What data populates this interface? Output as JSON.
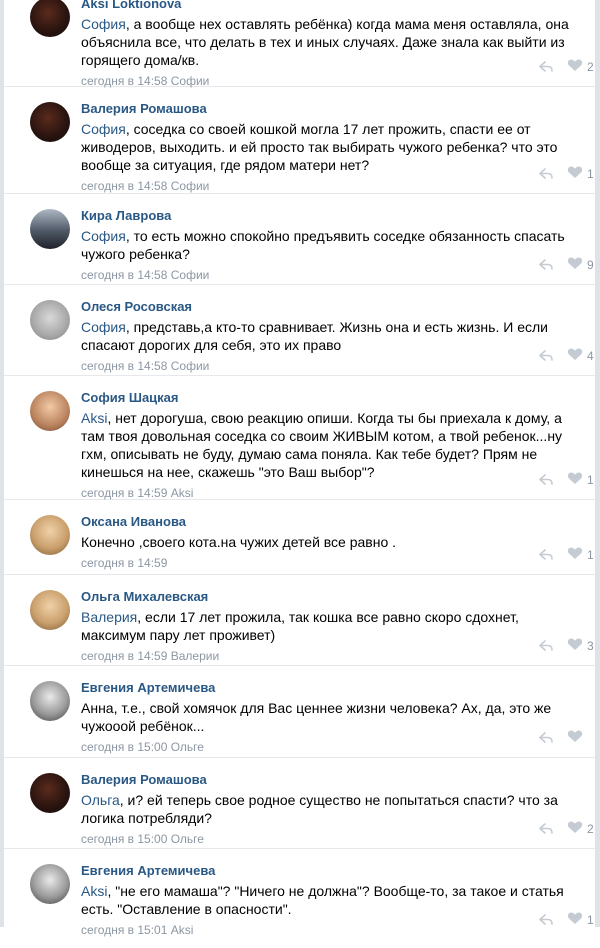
{
  "comments": [
    {
      "author": "Aksi Loktionova",
      "reply_to": "София",
      "text": ", а вообще нех оставлять ребёнка) когда мама меня оставляла, она объяснила все, что делать в тех и иных случаях. Даже знала как выйти из горящего дома/кв.",
      "meta": "сегодня в 14:58 Софии",
      "likes": "2",
      "avatar_icon": "avatar-photo"
    },
    {
      "author": "Валерия Ромашова",
      "reply_to": "София",
      "text": ", соседка со своей кошкой могла 17 лет прожить, спасти ее от живодеров, выходить. и ей просто так выбирать чужого ребенка? что это вообще за ситуация, где рядом матери нет?",
      "meta": "сегодня в 14:58 Софии",
      "likes": "1",
      "avatar_icon": "avatar-photo"
    },
    {
      "author": "Кира Лаврова",
      "reply_to": "София",
      "text": ", то есть можно спокойно предъявить соседке обязанность спасать чужого ребенка?",
      "meta": "сегодня в 14:58 Софии",
      "likes": "9",
      "avatar_icon": "avatar-photo"
    },
    {
      "author": "Олеся Росовская",
      "reply_to": "София",
      "text": ", представь,а кто-то сравнивает. Жизнь она и есть жизнь. И если спасают дорогих для себя, это их право",
      "meta": "сегодня в 14:58 Софии",
      "likes": "4",
      "avatar_icon": "avatar-photo"
    },
    {
      "author": "София Шацкая",
      "reply_to": "Aksi",
      "text": ", нет дорогуша, свою реакцию опиши. Когда ты бы приехала к дому, а там твоя довольная соседка со своим ЖИВЫМ котом, а твой ребенок...ну гхм, описывать не буду, думаю сама поняла. Как тебе будет? Прям не кинешься на нее, скажешь \"это Ваш выбор\"?",
      "meta": "сегодня в 14:59 Aksi",
      "likes": "1",
      "avatar_icon": "avatar-photo"
    },
    {
      "author": "Оксана Иванова",
      "reply_to": "",
      "text": "Конечно ,своего кота.на чужих детей все равно .",
      "meta": "сегодня в 14:59",
      "likes": "1",
      "avatar_icon": "avatar-photo"
    },
    {
      "author": "Ольга Михалевская",
      "reply_to": "Валерия",
      "text": ", если 17 лет прожила, так кошка все равно скоро сдохнет, максимум пару лет проживет)",
      "meta": "сегодня в 14:59 Валерии",
      "likes": "3",
      "avatar_icon": "avatar-photo"
    },
    {
      "author": "Евгения Артемичева",
      "reply_to": "",
      "text": "Анна, т.е., свой хомячок для Вас ценнее жизни человека? Ах, да, это же чужооой ребёнок...",
      "meta": "сегодня в 15:00 Ольге",
      "likes": "",
      "avatar_icon": "avatar-photo"
    },
    {
      "author": "Валерия Ромашова",
      "reply_to": "Ольга",
      "text": ", и? ей теперь свое родное существо не попытаться спасти? что за логика потребляди?",
      "meta": "сегодня в 15:00 Ольге",
      "likes": "2",
      "avatar_icon": "avatar-photo"
    },
    {
      "author": "Евгения Артемичева",
      "reply_to": "Aksi",
      "text": ", \"не его мамаша\"? \"Ничего не должна\"?  Вообще-то, за такое и статья есть. \"Оставление в опасности\".",
      "meta": "сегодня в 15:01 Aksi",
      "likes": "1",
      "avatar_icon": "avatar-photo"
    }
  ],
  "icons": {
    "reply": "reply-arrow-icon",
    "like": "heart-icon"
  },
  "colors": {
    "link": "#2a5885",
    "meta": "#8c97a3",
    "divider": "#e6e8eb"
  }
}
